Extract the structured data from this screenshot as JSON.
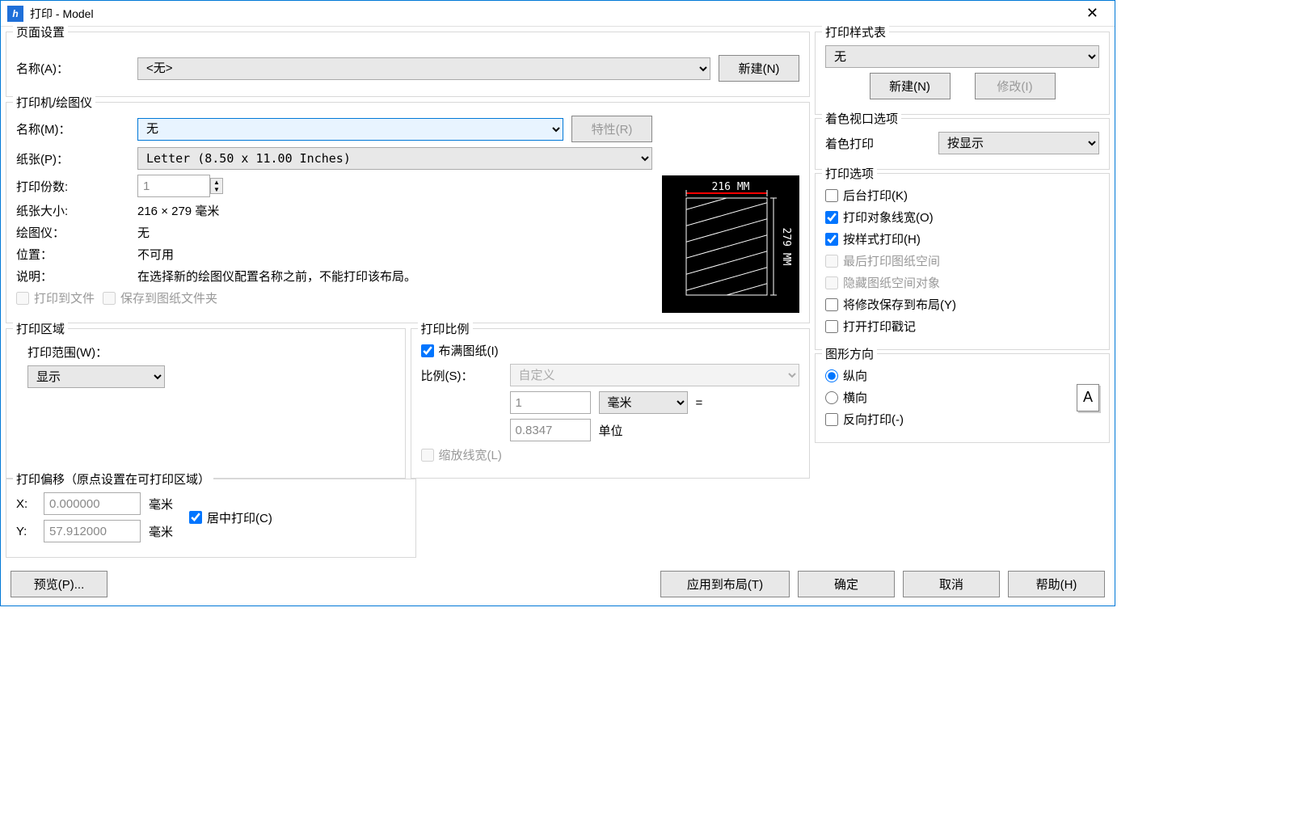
{
  "title": "打印 - Model",
  "pageSetup": {
    "legend": "页面设置",
    "nameLabel": "名称(A)：",
    "nameValue": "<无>",
    "newBtn": "新建(N)"
  },
  "printer": {
    "legend": "打印机/绘图仪",
    "nameLabel": "名称(M)：",
    "nameValue": "无",
    "propsBtn": "特性(R)",
    "paperLabel": "纸张(P)：",
    "paperValue": "Letter (8.50 x 11.00 Inches)",
    "copiesLabel": "打印份数:",
    "copiesValue": "1",
    "sizeLabel": "纸张大小:",
    "sizeValue": "216 × 279  毫米",
    "plotterLabel": "绘图仪：",
    "plotterValue": "无",
    "locLabel": "位置：",
    "locValue": "不可用",
    "descLabel": "说明：",
    "descValue": "在选择新的绘图仪配置名称之前，不能打印该布局。",
    "printToFile": "打印到文件",
    "saveToSheet": "保存到图纸文件夹",
    "previewW": "216 MM",
    "previewH": "279 MM"
  },
  "area": {
    "legend": "打印区域",
    "rangeLabel": "打印范围(W)：",
    "rangeValue": "显示"
  },
  "scale": {
    "legend": "打印比例",
    "fit": "布满图纸(I)",
    "ratioLabel": "比例(S)：",
    "ratioValue": "自定义",
    "v1": "1",
    "unit1": "毫米",
    "eq": "=",
    "v2": "0.8347",
    "unit2": "单位",
    "scaleLW": "缩放线宽(L)"
  },
  "offset": {
    "legend": "打印偏移（原点设置在可打印区域）",
    "xLabel": "X:",
    "xValue": "0.000000",
    "yLabel": "Y:",
    "yValue": "57.912000",
    "mm": "毫米",
    "center": "居中打印(C)"
  },
  "styleTable": {
    "legend": "打印样式表",
    "value": "无",
    "newBtn": "新建(N)",
    "modBtn": "修改(I)"
  },
  "shade": {
    "legend": "着色视口选项",
    "label": "着色打印",
    "value": "按显示"
  },
  "options": {
    "legend": "打印选项",
    "bg": "后台打印(K)",
    "lw": "打印对象线宽(O)",
    "style": "按样式打印(H)",
    "pspace": "最后打印图纸空间",
    "hide": "隐藏图纸空间对象",
    "save": "将修改保存到布局(Y)",
    "stamp": "打开打印戳记"
  },
  "orient": {
    "legend": "图形方向",
    "portrait": "纵向",
    "landscape": "横向",
    "reverse": "反向打印(-)"
  },
  "buttons": {
    "preview": "预览(P)...",
    "apply": "应用到布局(T)",
    "ok": "确定",
    "cancel": "取消",
    "help": "帮助(H)"
  }
}
